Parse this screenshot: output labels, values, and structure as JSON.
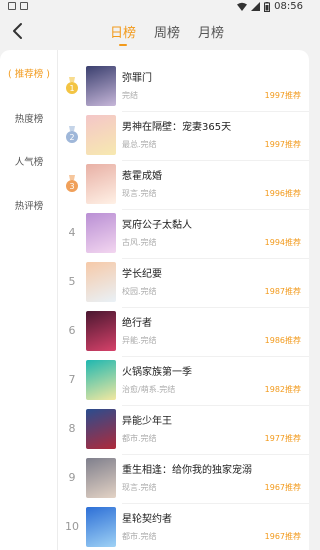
{
  "statusbar": {
    "time": "08:56"
  },
  "header": {
    "tabs": [
      {
        "label": "日榜"
      },
      {
        "label": "周榜"
      },
      {
        "label": "月榜"
      }
    ]
  },
  "sidebar": {
    "items": [
      {
        "label": "( 推荐榜 )"
      },
      {
        "label": "热度榜"
      },
      {
        "label": "人气榜"
      },
      {
        "label": "热评榜"
      }
    ]
  },
  "list": {
    "items": [
      {
        "rank": "1",
        "title": "弥罪门",
        "tag": "完结",
        "year": "1997推荐",
        "colors": [
          "#3a3f6e",
          "#c7b7d9"
        ]
      },
      {
        "rank": "2",
        "title": "男神在隔壁：宠妻365天",
        "tag": "最总.完结",
        "year": "1997推荐",
        "colors": [
          "#f4c6c8",
          "#f7e9b0"
        ]
      },
      {
        "rank": "3",
        "title": "惹霍成婚",
        "tag": "现言.完结",
        "year": "1996推荐",
        "colors": [
          "#e8b0a5",
          "#fff1e6"
        ]
      },
      {
        "rank": "4",
        "title": "冥府公子太黏人",
        "tag": "古风.完结",
        "year": "1994推荐",
        "colors": [
          "#b98fd4",
          "#f3d6f0"
        ]
      },
      {
        "rank": "5",
        "title": "学长纪要",
        "tag": "校园.完结",
        "year": "1987推荐",
        "colors": [
          "#f6c9a8",
          "#e9f1f7"
        ]
      },
      {
        "rank": "6",
        "title": "绝行者",
        "tag": "异能.完结",
        "year": "1986推荐",
        "colors": [
          "#4a1730",
          "#d7426a"
        ]
      },
      {
        "rank": "7",
        "title": "火锅家族第一季",
        "tag": "治愈/萌系.完结",
        "year": "1982推荐",
        "colors": [
          "#1fb7b0",
          "#f3e8a0"
        ]
      },
      {
        "rank": "8",
        "title": "异能少年王",
        "tag": "都市.完结",
        "year": "1977推荐",
        "colors": [
          "#2a4d8f",
          "#b02a3a"
        ]
      },
      {
        "rank": "9",
        "title": "重生相逢：给你我的独家宠溺",
        "tag": "现言.完结",
        "year": "1967推荐",
        "colors": [
          "#7f7f8c",
          "#e4d3c5"
        ]
      },
      {
        "rank": "10",
        "title": "星轮契约者",
        "tag": "都市.完结",
        "year": "1967推荐",
        "colors": [
          "#2d6fd6",
          "#9fd2f5"
        ]
      }
    ]
  }
}
